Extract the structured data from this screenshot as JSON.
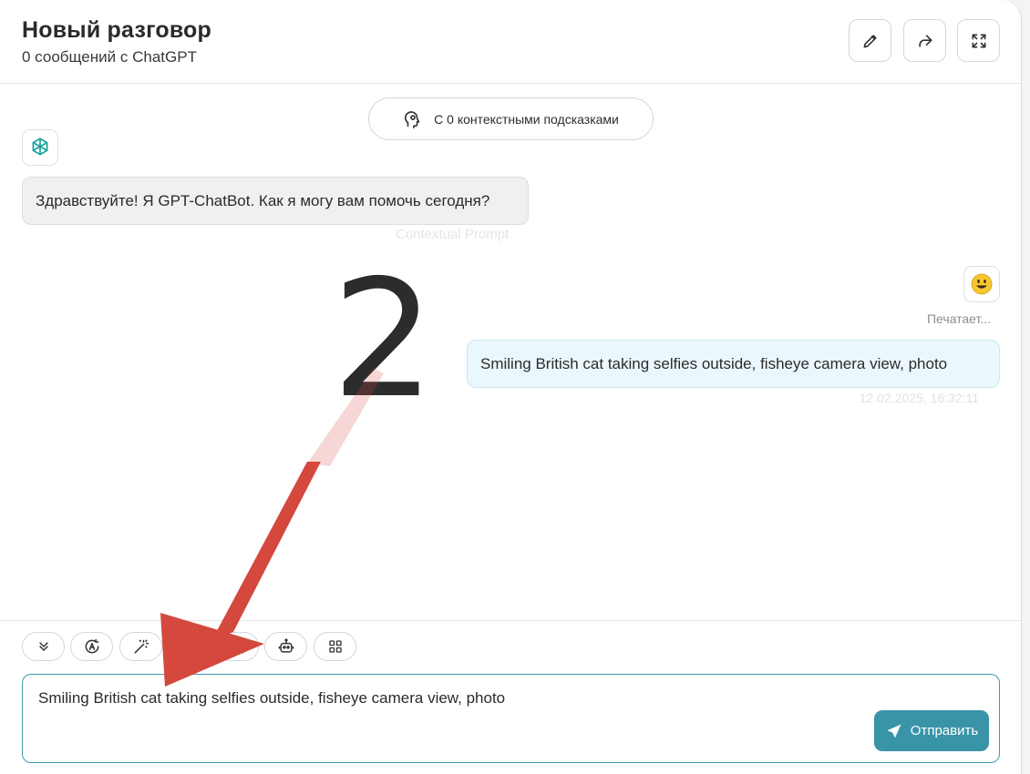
{
  "header": {
    "title": "Новый разговор",
    "subtitle": "0 сообщений с ChatGPT",
    "buttons": [
      {
        "icon": "pencil-icon"
      },
      {
        "icon": "share-icon"
      },
      {
        "icon": "fullscreen-icon"
      }
    ]
  },
  "context": {
    "label": "С 0 контекстными подсказками",
    "icon": "brain-head-icon"
  },
  "messages": {
    "bot": {
      "avatar_icon": "openai-logo-icon",
      "text": "Здравствуйте! Я GPT-ChatBot. Как я могу вам помочь сегодня?",
      "faded_label": "Contextual Prompt"
    },
    "user": {
      "avatar_icon": "smiley-emoji-icon",
      "status": "Печатает...",
      "text": "Smiling British cat taking selfies outside, fisheye camera view, photo",
      "timestamp": "12.02.2025, 16:32:11"
    }
  },
  "annotation": {
    "step": "2",
    "arrow_color": "#d4483e"
  },
  "toolbar": {
    "tools": [
      {
        "icon": "double-chevron-down-icon"
      },
      {
        "icon": "auto-letter-icon"
      },
      {
        "icon": "magic-wand-icon"
      },
      {
        "icon": "globe-icon"
      },
      {
        "icon": "image-icon"
      },
      {
        "icon": "robot-icon"
      },
      {
        "icon": "grid-icon"
      }
    ]
  },
  "input": {
    "value": "Smiling British cat taking selfies outside, fisheye camera view, photo",
    "send_label": "Отправить",
    "send_icon": "send-icon"
  },
  "colors": {
    "accent": "#3a94a8",
    "user_bubble": "#eaf8fd",
    "bot_bubble": "#f0f0f1"
  }
}
